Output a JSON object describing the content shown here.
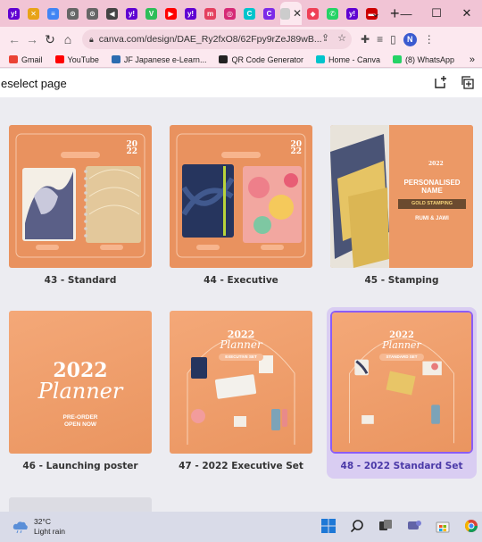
{
  "browser": {
    "tabs": [
      {
        "icon": "yahoo-icon",
        "color": "#6001d2",
        "glyph": "y!"
      },
      {
        "icon": "x-tab-icon",
        "color": "#e8a317",
        "glyph": "✕"
      },
      {
        "icon": "docs-icon",
        "color": "#4285f4",
        "glyph": "≡"
      },
      {
        "icon": "tab-globe-icon",
        "color": "#666666",
        "glyph": "⊙"
      },
      {
        "icon": "tab-globe-icon",
        "color": "#666666",
        "glyph": "⊙"
      },
      {
        "icon": "sound-icon",
        "color": "#444444",
        "glyph": "◀"
      },
      {
        "icon": "yahoo-icon",
        "color": "#6001d2",
        "glyph": "y!"
      },
      {
        "icon": "vee-icon",
        "color": "#2ebd59",
        "glyph": "V"
      },
      {
        "icon": "youtube-icon",
        "color": "#ff0000",
        "glyph": "▶"
      },
      {
        "icon": "yahoo-icon",
        "color": "#6001d2",
        "glyph": "y!"
      },
      {
        "icon": "ms-icon",
        "color": "#e4405f",
        "glyph": "m"
      },
      {
        "icon": "instagram-icon",
        "color": "#d62976",
        "glyph": "◎"
      },
      {
        "icon": "canva-icon",
        "color": "#00c4cc",
        "glyph": "C"
      },
      {
        "icon": "canva-icon",
        "color": "#7d2ae8",
        "glyph": "C"
      }
    ],
    "active_tab_icon": {
      "color": "#cccccc"
    },
    "tabs_after": [
      {
        "icon": "pocket-icon",
        "color": "#ef4056",
        "glyph": "◆"
      },
      {
        "icon": "whatsapp-icon",
        "color": "#25d366",
        "glyph": "✆"
      },
      {
        "icon": "yahoo-icon",
        "color": "#6001d2",
        "glyph": "y!"
      },
      {
        "icon": "flag-icon",
        "color": "#cc0000",
        "glyph": "▬"
      }
    ],
    "url": "canva.com/design/DAE_Ry2fxO8/62Fpy9rZeJ89wB...",
    "profile_initial": "N",
    "accent": "#f1c4d5",
    "bookmarks": [
      {
        "label": "Gmail",
        "color": "#ea4335"
      },
      {
        "label": "YouTube",
        "color": "#ff0000"
      },
      {
        "label": "JF Japanese e-Learn...",
        "color": "#2b6cb0"
      },
      {
        "label": "QR Code Generator",
        "color": "#222222"
      },
      {
        "label": "Home - Canva",
        "color": "#00c4cc"
      },
      {
        "label": "(8) WhatsApp",
        "color": "#25d366"
      }
    ]
  },
  "canva": {
    "header_title": "eselect page",
    "pages": [
      {
        "label": "43 - Standard",
        "selected": false
      },
      {
        "label": "44 - Executive",
        "selected": false
      },
      {
        "label": "45 - Stamping",
        "selected": false
      },
      {
        "label": "46 - Launching poster",
        "selected": false
      },
      {
        "label": "47 - 2022 Executive Set",
        "selected": false
      },
      {
        "label": "48 - 2022 Standard Set",
        "selected": true
      }
    ],
    "thumb_text": {
      "year_short": "20\n22",
      "year": "2022",
      "script": "Planner",
      "preorder": "PRE-ORDER\nOPEN NOW",
      "exec_set": "EXECUTIVE SET",
      "std_set": "STANDARD SET",
      "personalised": "PERSONALISED\nNAME",
      "gold": "GOLD STAMPING",
      "rumi": "RUMI & JAWI"
    },
    "selection_color": "#8b5cf6"
  },
  "taskbar": {
    "temperature": "32°C",
    "condition": "Light rain"
  }
}
